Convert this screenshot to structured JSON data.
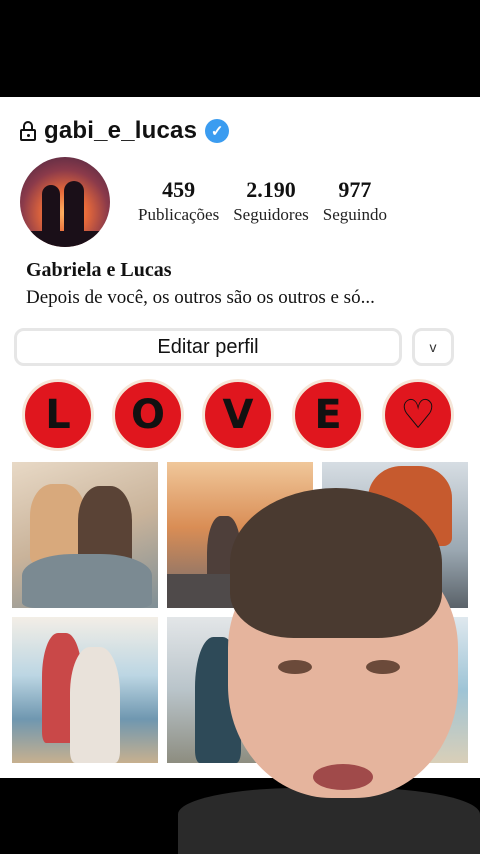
{
  "profile": {
    "username": "gabi_e_lucas",
    "verified_glyph": "✓",
    "display_name": "Gabriela e Lucas",
    "bio": "Depois de você, os outros são os outros e só...",
    "stats": [
      {
        "value": "459",
        "label": "Publicações"
      },
      {
        "value": "2.190",
        "label": "Seguidores"
      },
      {
        "value": "977",
        "label": "Seguindo"
      }
    ],
    "edit_label": "Editar perfil",
    "dropdown_glyph": "v"
  },
  "highlights": [
    {
      "text": "L"
    },
    {
      "text": "O"
    },
    {
      "text": "V"
    },
    {
      "text": "E"
    },
    {
      "text": "♡"
    }
  ],
  "icons": {
    "lock": "lock-icon",
    "verified": "verified-badge-icon",
    "chevron": "chevron-down-icon"
  },
  "colors": {
    "highlight_red": "#e0161e",
    "verified_blue": "#3b9cf0"
  }
}
